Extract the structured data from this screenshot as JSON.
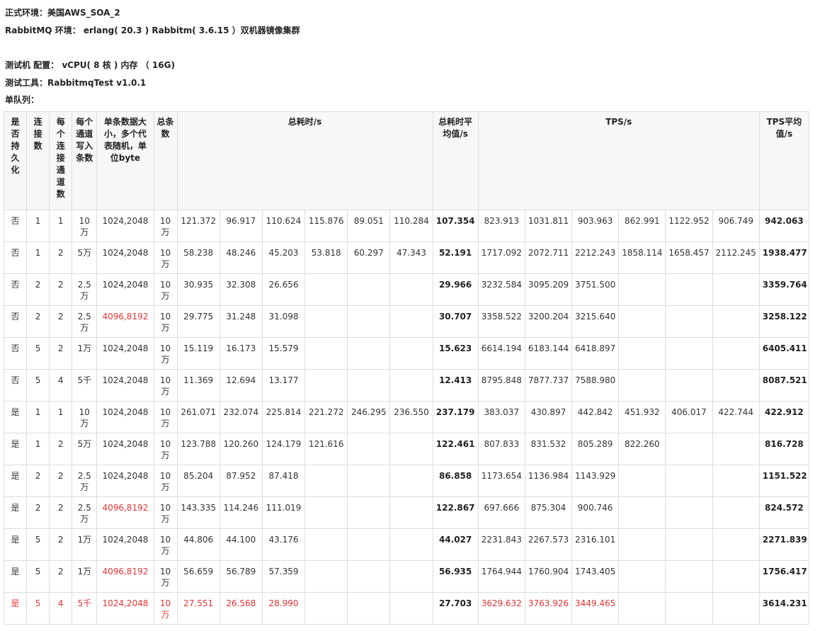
{
  "info": {
    "line1": "正式环境：美国AWS_SOA_2",
    "line2": "RabbitMQ 环境：   erlang( 20.3 ) Rabbitm( 3.6.15 ）双机器镜像集群",
    "line3": "测试机 配置：  vCPU( 8 核 ) 内存 （ 16G)",
    "line4": "测试工具：RabbitmqTest v1.0.1",
    "line5": "单队列："
  },
  "table": {
    "headers": {
      "persist": "是否持久化",
      "conn": "连接数",
      "chan": "每个连接通道数",
      "write": "每个通道写入条数",
      "size": "单条数据大小，多个代表随机，单位byte",
      "total": "总条数",
      "time": "总耗时/s",
      "time_avg": "总耗时平均值/s",
      "tps": "TPS/s",
      "tps_avg": "TPS平均值/s"
    },
    "rows": [
      {
        "c": [
          "否",
          "1",
          "1",
          "10万",
          "1024,2048",
          "10万",
          "121.372",
          "96.917",
          "110.624",
          "115.876",
          "89.051",
          "110.284",
          "107.354",
          "823.913",
          "1031.811",
          "903.963",
          "862.991",
          "1122.952",
          "906.749",
          "942.063"
        ],
        "red_size": false,
        "red_all": false
      },
      {
        "c": [
          "否",
          "1",
          "2",
          "5万",
          "1024,2048",
          "10万",
          "58.238",
          "48.246",
          "45.203",
          "53.818",
          "60.297",
          "47.343",
          "52.191",
          "1717.092",
          "2072.711",
          "2212.243",
          "1858.114",
          "1658.457",
          "2112.245",
          "1938.477"
        ],
        "red_size": false,
        "red_all": false
      },
      {
        "c": [
          "否",
          "2",
          "2",
          "2.5万",
          "1024,2048",
          "10万",
          "30.935",
          "32.308",
          "26.656",
          "",
          "",
          "",
          "29.966",
          "3232.584",
          "3095.209",
          "3751.500",
          "",
          "",
          "",
          "3359.764"
        ],
        "red_size": false,
        "red_all": false
      },
      {
        "c": [
          "否",
          "2",
          "2",
          "2.5万",
          "4096,8192",
          "10万",
          "29.775",
          "31.248",
          "31.098",
          "",
          "",
          "",
          "30.707",
          "3358.522",
          "3200.204",
          "3215.640",
          "",
          "",
          "",
          "3258.122"
        ],
        "red_size": true,
        "red_all": false
      },
      {
        "c": [
          "否",
          "5",
          "2",
          "1万",
          "1024,2048",
          "10万",
          "15.119",
          "16.173",
          "15.579",
          "",
          "",
          "",
          "15.623",
          "6614.194",
          "6183.144",
          "6418.897",
          "",
          "",
          "",
          "6405.411"
        ],
        "red_size": false,
        "red_all": false
      },
      {
        "c": [
          "否",
          "5",
          "4",
          "5千",
          "1024,2048",
          "10万",
          "11.369",
          "12.694",
          "13.177",
          "",
          "",
          "",
          "12.413",
          "8795.848",
          "7877.737",
          "7588.980",
          "",
          "",
          "",
          "8087.521"
        ],
        "red_size": false,
        "red_all": false
      },
      {
        "c": [
          "是",
          "1",
          "1",
          "10万",
          "1024,2048",
          "10万",
          "261.071",
          "232.074",
          "225.814",
          "221.272",
          "246.295",
          "236.550",
          "237.179",
          "383.037",
          "430.897",
          "442.842",
          "451.932",
          "406.017",
          "422.744",
          "422.912"
        ],
        "red_size": false,
        "red_all": false
      },
      {
        "c": [
          "是",
          "1",
          "2",
          "5万",
          "1024,2048",
          "10万",
          "123.788",
          "120.260",
          "124.179",
          "121.616",
          "",
          "",
          "122.461",
          "807.833",
          "831.532",
          "805.289",
          "822.260",
          "",
          "",
          "816.728"
        ],
        "red_size": false,
        "red_all": false
      },
      {
        "c": [
          "是",
          "2",
          "2",
          "2.5万",
          "1024,2048",
          "10万",
          "85.204",
          "87.952",
          "87.418",
          "",
          "",
          "",
          "86.858",
          "1173.654",
          "1136.984",
          "1143.929",
          "",
          "",
          "",
          "1151.522"
        ],
        "red_size": false,
        "red_all": false
      },
      {
        "c": [
          "是",
          "2",
          "2",
          "2.5万",
          "4096,8192",
          "10万",
          "143.335",
          "114.246",
          "111.019",
          "",
          "",
          "",
          "122.867",
          "697.666",
          "875.304",
          "900.746",
          "",
          "",
          "",
          "824.572"
        ],
        "red_size": true,
        "red_all": false
      },
      {
        "c": [
          "是",
          "5",
          "2",
          "1万",
          "1024,2048",
          "10万",
          "44.806",
          "44.100",
          "43.176",
          "",
          "",
          "",
          "44.027",
          "2231.843",
          "2267.573",
          "2316.101",
          "",
          "",
          "",
          "2271.839"
        ],
        "red_size": false,
        "red_all": false
      },
      {
        "c": [
          "是",
          "5",
          "2",
          "1万",
          "4096,8192",
          "10万",
          "56.659",
          "56.789",
          "57.359",
          "",
          "",
          "",
          "56.935",
          "1764.944",
          "1760.904",
          "1743.405",
          "",
          "",
          "",
          "1756.417"
        ],
        "red_size": true,
        "red_all": false
      },
      {
        "c": [
          "是",
          "5",
          "4",
          "5千",
          "1024,2048",
          "10万",
          "27.551",
          "26.568",
          "28.990",
          "",
          "",
          "",
          "27.703",
          "3629.632",
          "3763.926",
          "3449.465",
          "",
          "",
          "",
          "3614.231"
        ],
        "red_size": false,
        "red_all": true
      }
    ]
  }
}
